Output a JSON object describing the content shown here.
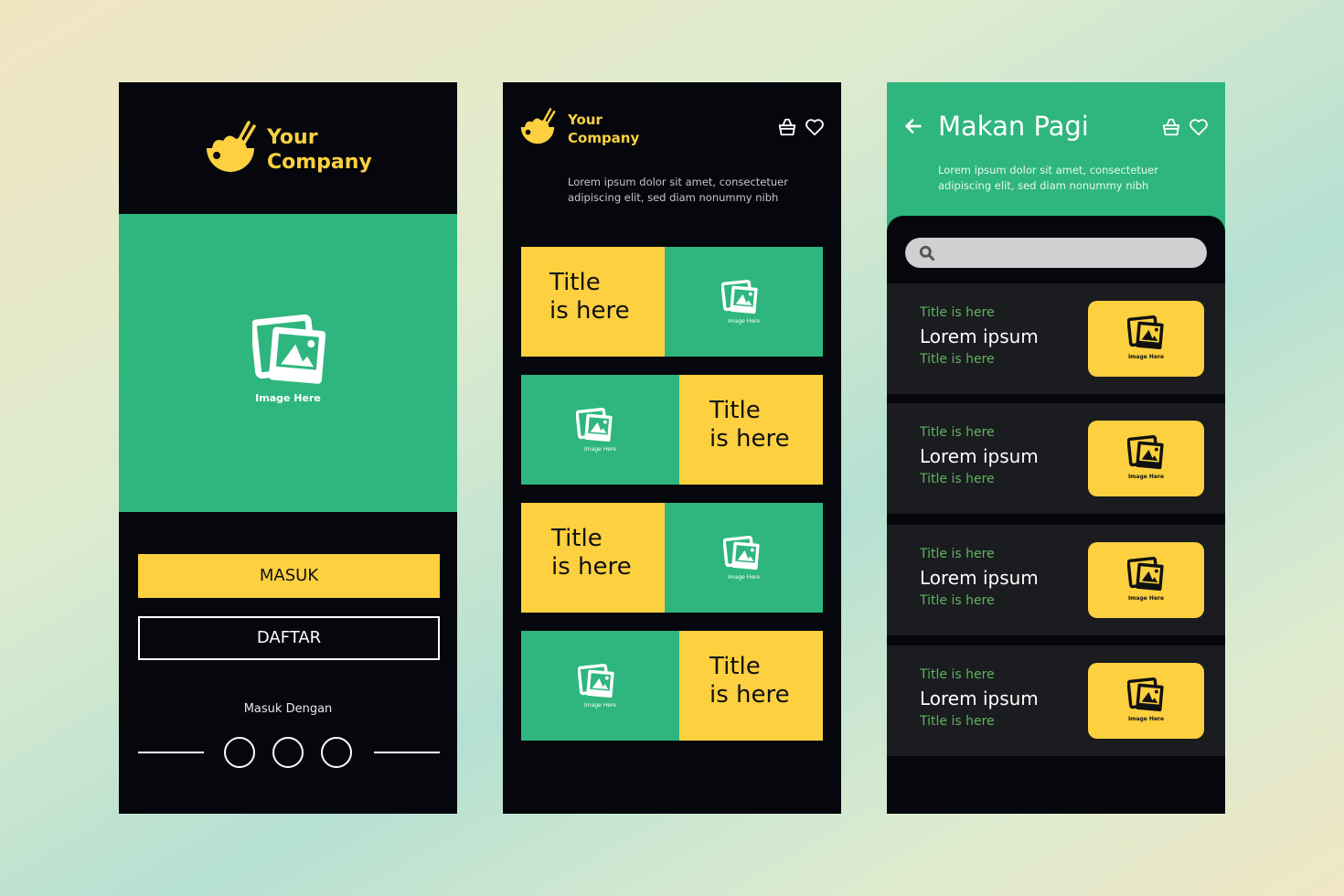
{
  "colors": {
    "yellow": "#fcd03f",
    "green": "#2eb67e",
    "dark": "#05070d",
    "list_bg": "#1a1c20",
    "list_green_text": "#5fb45a"
  },
  "screen1": {
    "brand": {
      "line1": "Your",
      "line2": "Company",
      "icon": "noodle-bowl-icon"
    },
    "hero": {
      "caption": "Image Here",
      "icon": "image-placeholder-icon"
    },
    "buttons": {
      "login": "MASUK",
      "register": "DAFTAR"
    },
    "social": {
      "label": "Masuk Dengan",
      "options": [
        "social-option-1",
        "social-option-2",
        "social-option-3"
      ]
    }
  },
  "screen2": {
    "brand": {
      "line1": "Your",
      "line2": "Company",
      "icon": "noodle-bowl-icon"
    },
    "header_icons": [
      "basket-icon",
      "heart-icon"
    ],
    "description": "Lorem ipsum dolor sit amet, consectetuer adipiscing elit, sed diam nonummy nibh",
    "cards": [
      {
        "title_line1": "Title",
        "title_line2": "is here",
        "image_caption": "Image Here",
        "layout": "text-left"
      },
      {
        "title_line1": "Title",
        "title_line2": "is here",
        "image_caption": "Image Here",
        "layout": "text-right"
      },
      {
        "title_line1": "Title",
        "title_line2": "is here",
        "image_caption": "Image Here",
        "layout": "text-left"
      },
      {
        "title_line1": "Title",
        "title_line2": "is here",
        "image_caption": "Image Here",
        "layout": "text-right"
      }
    ]
  },
  "screen3": {
    "title": "Makan Pagi",
    "header_icons": [
      "back-arrow-icon",
      "basket-icon",
      "heart-icon"
    ],
    "description": "Lorem ipsum dolor sit amet, consectetuer adipiscing elit, sed diam nonummy nibh",
    "search": {
      "placeholder": "",
      "value": ""
    },
    "items": [
      {
        "subtitle_top": "Title is here",
        "name": "Lorem ipsum",
        "subtitle_bottom": "Title is here",
        "image_caption": "Image Here"
      },
      {
        "subtitle_top": "Title is here",
        "name": "Lorem ipsum",
        "subtitle_bottom": "Title is here",
        "image_caption": "Image Here"
      },
      {
        "subtitle_top": "Title is here",
        "name": "Lorem ipsum",
        "subtitle_bottom": "Title is here",
        "image_caption": "Image Here"
      },
      {
        "subtitle_top": "Title is here",
        "name": "Lorem ipsum",
        "subtitle_bottom": "Title is here",
        "image_caption": "Image Here"
      }
    ]
  }
}
